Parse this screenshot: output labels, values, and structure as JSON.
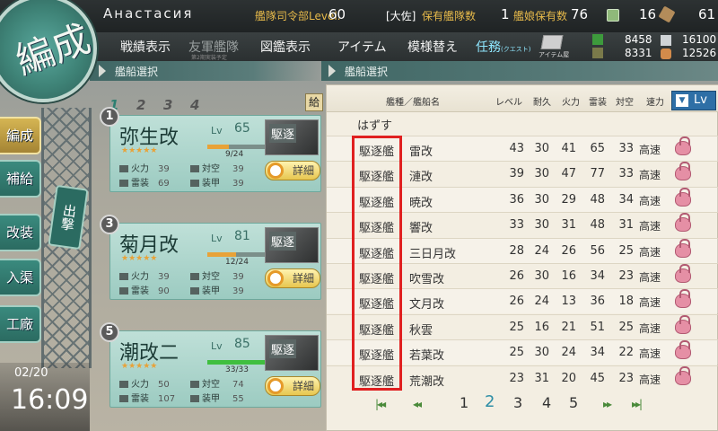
{
  "top": {
    "player_name": "Анастасия",
    "hq_label": "艦隊司令部Level.",
    "hq_level": "60",
    "rank": "[大佐]",
    "ships_owned_label": "保有艦隊数",
    "ships_owned": "1",
    "equip_owned_label": "艦娘保有数",
    "equip_owned": "76",
    "buckets": "16",
    "devmats": "61"
  },
  "nav": {
    "record": "戦績表示",
    "friend": "友軍艦隊",
    "friend_sub": "第2期実装予定",
    "library": "図鑑表示",
    "items": "アイテム",
    "furniture": "模様替え",
    "quest": "任務",
    "quest_sub": "(クエスト)",
    "item_shop": "アイテム屋"
  },
  "resources": {
    "fuel": "8458",
    "ammo": "8331",
    "steel": "16100",
    "bauxite": "12526"
  },
  "badge": "編成",
  "sidebar": {
    "organize": "編成",
    "supply": "補給",
    "remodel": "改装",
    "dock": "入渠",
    "arsenal": "工廠",
    "crane": "出撃"
  },
  "clock": {
    "date": "02/20",
    "time": "16:09"
  },
  "left_header": "艦船選択",
  "right_header": "艦船選択",
  "fleet_tabs": [
    "1",
    "2",
    "3",
    "4"
  ],
  "supply_mini": "給",
  "fleet": [
    {
      "num": "1",
      "name": "弥生改",
      "lv_label": "Lv",
      "lv": "65",
      "stars": "★★★★★",
      "hp": "9/24",
      "hp_ratio": 0.375,
      "hp_color": "#e8a238",
      "fire_label": "火力",
      "fire": "39",
      "aa_label": "対空",
      "aa": "39",
      "torp_label": "雷装",
      "torp": "69",
      "armor_label": "装甲",
      "armor": "39",
      "type_stamp": "駆逐",
      "detail": "詳細"
    },
    {
      "num": "3",
      "name": "菊月改",
      "lv_label": "Lv",
      "lv": "81",
      "stars": "★★★★★",
      "hp": "12/24",
      "hp_ratio": 0.5,
      "hp_color": "#e8a238",
      "fire_label": "火力",
      "fire": "39",
      "aa_label": "対空",
      "aa": "39",
      "torp_label": "雷装",
      "torp": "90",
      "armor_label": "装甲",
      "armor": "39",
      "type_stamp": "駆逐",
      "detail": "詳細"
    },
    {
      "num": "5",
      "name": "潮改二",
      "lv_label": "Lv",
      "lv": "85",
      "stars": "★★★★★",
      "hp": "33/33",
      "hp_ratio": 1.0,
      "hp_color": "#3fbf3f",
      "fire_label": "火力",
      "fire": "50",
      "aa_label": "対空",
      "aa": "74",
      "torp_label": "雷装",
      "torp": "107",
      "armor_label": "装甲",
      "armor": "55",
      "type_stamp": "駆逐",
      "detail": "詳細"
    }
  ],
  "list": {
    "headers": {
      "type": "艦種／艦船名",
      "level": "レベル",
      "hp": "耐久",
      "fire": "火力",
      "torp": "雷装",
      "aa": "対空",
      "speed": "速力"
    },
    "sort_label": "Lv",
    "sort_arrow": "▼",
    "unequip": "はずす",
    "rows": [
      {
        "type": "駆逐艦",
        "name": "雷改",
        "lv": "43",
        "hp": "30",
        "fire": "41",
        "torp": "65",
        "aa": "33",
        "speed": "高速"
      },
      {
        "type": "駆逐艦",
        "name": "漣改",
        "lv": "39",
        "hp": "30",
        "fire": "47",
        "torp": "77",
        "aa": "33",
        "speed": "高速"
      },
      {
        "type": "駆逐艦",
        "name": "暁改",
        "lv": "36",
        "hp": "30",
        "fire": "29",
        "torp": "48",
        "aa": "34",
        "speed": "高速"
      },
      {
        "type": "駆逐艦",
        "name": "響改",
        "lv": "33",
        "hp": "30",
        "fire": "31",
        "torp": "48",
        "aa": "31",
        "speed": "高速"
      },
      {
        "type": "駆逐艦",
        "name": "三日月改",
        "lv": "28",
        "hp": "24",
        "fire": "26",
        "torp": "56",
        "aa": "25",
        "speed": "高速"
      },
      {
        "type": "駆逐艦",
        "name": "吹雪改",
        "lv": "26",
        "hp": "30",
        "fire": "16",
        "torp": "34",
        "aa": "23",
        "speed": "高速"
      },
      {
        "type": "駆逐艦",
        "name": "文月改",
        "lv": "26",
        "hp": "24",
        "fire": "13",
        "torp": "36",
        "aa": "18",
        "speed": "高速"
      },
      {
        "type": "駆逐艦",
        "name": "秋雲",
        "lv": "25",
        "hp": "16",
        "fire": "21",
        "torp": "51",
        "aa": "25",
        "speed": "高速"
      },
      {
        "type": "駆逐艦",
        "name": "若葉改",
        "lv": "25",
        "hp": "30",
        "fire": "24",
        "torp": "34",
        "aa": "22",
        "speed": "高速"
      },
      {
        "type": "駆逐艦",
        "name": "荒潮改",
        "lv": "23",
        "hp": "31",
        "fire": "20",
        "torp": "45",
        "aa": "23",
        "speed": "高速"
      }
    ],
    "pager": {
      "first": "|◂◂",
      "prev": "◂◂",
      "pages": [
        "1",
        "2",
        "3",
        "4",
        "5"
      ],
      "next": "▸▸",
      "last": "▸▸|"
    }
  },
  "colors": {
    "accent_teal": "#3e8276",
    "highlight_red": "#e02020",
    "quest_blue": "#8fe7ff"
  }
}
